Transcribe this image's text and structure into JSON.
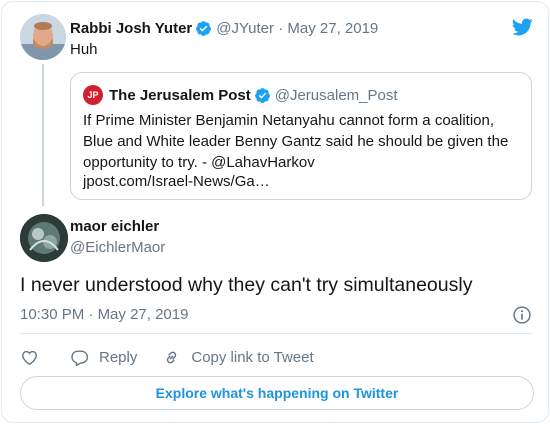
{
  "parent_tweet": {
    "author_name": "Rabbi Josh Yuter",
    "handle": "@JYuter",
    "date": "May 27, 2019",
    "text": "Huh",
    "verified": true
  },
  "quoted_tweet": {
    "logo_text": "JP",
    "author_name": "The Jerusalem Post",
    "handle": "@Jerusalem_Post",
    "verified": true,
    "text": "If Prime Minister Benjamin Netanyahu cannot form a coalition, Blue and White leader Benny Gantz said he should be given the opportunity to try. - @LahavHarkov",
    "link": "jpost.com/Israel-News/Ga…"
  },
  "reply_tweet": {
    "author_name": "maor eichler",
    "handle": "@EichlerMaor",
    "text": "I never understood why they can't try simultaneously",
    "time": "10:30 PM",
    "date": "May 27, 2019"
  },
  "actions": {
    "like_icon": "heart-icon",
    "reply_label": "Reply",
    "copy_link_label": "Copy link to Tweet"
  },
  "explore_label": "Explore what's happening on Twitter",
  "colors": {
    "brand_blue": "#1da1f2",
    "link_blue": "#1b95e0",
    "muted": "#657786",
    "border": "#e1e8ed",
    "jpost_red": "#d1202f"
  }
}
